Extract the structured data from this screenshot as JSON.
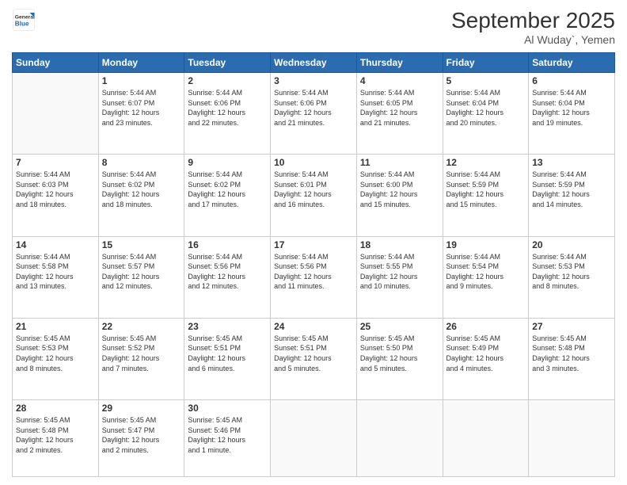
{
  "header": {
    "logo_general": "General",
    "logo_blue": "Blue",
    "month_year": "September 2025",
    "location": "Al Wuday`, Yemen"
  },
  "days_of_week": [
    "Sunday",
    "Monday",
    "Tuesday",
    "Wednesday",
    "Thursday",
    "Friday",
    "Saturday"
  ],
  "weeks": [
    [
      {
        "num": "",
        "info": ""
      },
      {
        "num": "1",
        "info": "Sunrise: 5:44 AM\nSunset: 6:07 PM\nDaylight: 12 hours\nand 23 minutes."
      },
      {
        "num": "2",
        "info": "Sunrise: 5:44 AM\nSunset: 6:06 PM\nDaylight: 12 hours\nand 22 minutes."
      },
      {
        "num": "3",
        "info": "Sunrise: 5:44 AM\nSunset: 6:06 PM\nDaylight: 12 hours\nand 21 minutes."
      },
      {
        "num": "4",
        "info": "Sunrise: 5:44 AM\nSunset: 6:05 PM\nDaylight: 12 hours\nand 21 minutes."
      },
      {
        "num": "5",
        "info": "Sunrise: 5:44 AM\nSunset: 6:04 PM\nDaylight: 12 hours\nand 20 minutes."
      },
      {
        "num": "6",
        "info": "Sunrise: 5:44 AM\nSunset: 6:04 PM\nDaylight: 12 hours\nand 19 minutes."
      }
    ],
    [
      {
        "num": "7",
        "info": "Sunrise: 5:44 AM\nSunset: 6:03 PM\nDaylight: 12 hours\nand 18 minutes."
      },
      {
        "num": "8",
        "info": "Sunrise: 5:44 AM\nSunset: 6:02 PM\nDaylight: 12 hours\nand 18 minutes."
      },
      {
        "num": "9",
        "info": "Sunrise: 5:44 AM\nSunset: 6:02 PM\nDaylight: 12 hours\nand 17 minutes."
      },
      {
        "num": "10",
        "info": "Sunrise: 5:44 AM\nSunset: 6:01 PM\nDaylight: 12 hours\nand 16 minutes."
      },
      {
        "num": "11",
        "info": "Sunrise: 5:44 AM\nSunset: 6:00 PM\nDaylight: 12 hours\nand 15 minutes."
      },
      {
        "num": "12",
        "info": "Sunrise: 5:44 AM\nSunset: 5:59 PM\nDaylight: 12 hours\nand 15 minutes."
      },
      {
        "num": "13",
        "info": "Sunrise: 5:44 AM\nSunset: 5:59 PM\nDaylight: 12 hours\nand 14 minutes."
      }
    ],
    [
      {
        "num": "14",
        "info": "Sunrise: 5:44 AM\nSunset: 5:58 PM\nDaylight: 12 hours\nand 13 minutes."
      },
      {
        "num": "15",
        "info": "Sunrise: 5:44 AM\nSunset: 5:57 PM\nDaylight: 12 hours\nand 12 minutes."
      },
      {
        "num": "16",
        "info": "Sunrise: 5:44 AM\nSunset: 5:56 PM\nDaylight: 12 hours\nand 12 minutes."
      },
      {
        "num": "17",
        "info": "Sunrise: 5:44 AM\nSunset: 5:56 PM\nDaylight: 12 hours\nand 11 minutes."
      },
      {
        "num": "18",
        "info": "Sunrise: 5:44 AM\nSunset: 5:55 PM\nDaylight: 12 hours\nand 10 minutes."
      },
      {
        "num": "19",
        "info": "Sunrise: 5:44 AM\nSunset: 5:54 PM\nDaylight: 12 hours\nand 9 minutes."
      },
      {
        "num": "20",
        "info": "Sunrise: 5:44 AM\nSunset: 5:53 PM\nDaylight: 12 hours\nand 8 minutes."
      }
    ],
    [
      {
        "num": "21",
        "info": "Sunrise: 5:45 AM\nSunset: 5:53 PM\nDaylight: 12 hours\nand 8 minutes."
      },
      {
        "num": "22",
        "info": "Sunrise: 5:45 AM\nSunset: 5:52 PM\nDaylight: 12 hours\nand 7 minutes."
      },
      {
        "num": "23",
        "info": "Sunrise: 5:45 AM\nSunset: 5:51 PM\nDaylight: 12 hours\nand 6 minutes."
      },
      {
        "num": "24",
        "info": "Sunrise: 5:45 AM\nSunset: 5:51 PM\nDaylight: 12 hours\nand 5 minutes."
      },
      {
        "num": "25",
        "info": "Sunrise: 5:45 AM\nSunset: 5:50 PM\nDaylight: 12 hours\nand 5 minutes."
      },
      {
        "num": "26",
        "info": "Sunrise: 5:45 AM\nSunset: 5:49 PM\nDaylight: 12 hours\nand 4 minutes."
      },
      {
        "num": "27",
        "info": "Sunrise: 5:45 AM\nSunset: 5:48 PM\nDaylight: 12 hours\nand 3 minutes."
      }
    ],
    [
      {
        "num": "28",
        "info": "Sunrise: 5:45 AM\nSunset: 5:48 PM\nDaylight: 12 hours\nand 2 minutes."
      },
      {
        "num": "29",
        "info": "Sunrise: 5:45 AM\nSunset: 5:47 PM\nDaylight: 12 hours\nand 2 minutes."
      },
      {
        "num": "30",
        "info": "Sunrise: 5:45 AM\nSunset: 5:46 PM\nDaylight: 12 hours\nand 1 minute."
      },
      {
        "num": "",
        "info": ""
      },
      {
        "num": "",
        "info": ""
      },
      {
        "num": "",
        "info": ""
      },
      {
        "num": "",
        "info": ""
      }
    ]
  ]
}
